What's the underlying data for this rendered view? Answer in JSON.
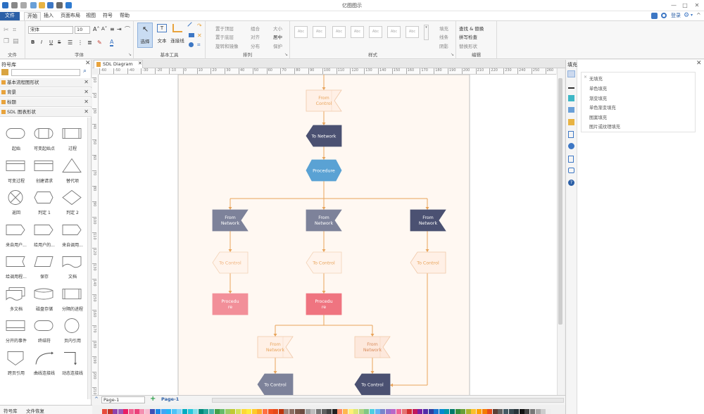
{
  "app": {
    "title": "亿图图示",
    "login_label": "登录",
    "settings_caret": "▾"
  },
  "menu": [
    {
      "label": "文件"
    },
    {
      "label": "开始"
    },
    {
      "label": "插入"
    },
    {
      "label": "页面布局"
    },
    {
      "label": "视图"
    },
    {
      "label": "符号"
    },
    {
      "label": "帮助"
    }
  ],
  "ribbon": {
    "groups": {
      "file": "文件",
      "font": "字体",
      "basic_tools": "基本工具",
      "arrange": "排列",
      "style": "样式",
      "edit": "编辑"
    },
    "font_name": "宋体",
    "font_size": "10",
    "format_buttons": [
      "B",
      "I",
      "U",
      "S"
    ],
    "tools": {
      "select": "选择",
      "text": "文本",
      "connector": "连接线"
    },
    "arrange": {
      "bring_front": "置于顶层",
      "send_back": "置于底层",
      "rotate": "旋转和镜像",
      "group": "组合",
      "align": "对齐",
      "distribute": "分布",
      "size": "大小",
      "center": "居中",
      "protect": "保护"
    },
    "style_thumb": "Abc",
    "fill": "填充",
    "line": "线条",
    "shadow": "阴影",
    "edit": {
      "find": "查找 & 替换",
      "spell": "拼写检查",
      "replace_shape": "替换形状"
    }
  },
  "library": {
    "title": "符号库",
    "search_placeholder": "",
    "categories": [
      {
        "label": "基本流程图形状"
      },
      {
        "label": "背景"
      },
      {
        "label": "标题"
      },
      {
        "label": "SDL 图表形状"
      }
    ],
    "shapes": [
      {
        "label": "起始"
      },
      {
        "label": "可变起始点"
      },
      {
        "label": "过程"
      },
      {
        "label": "可变过程"
      },
      {
        "label": "创建请求"
      },
      {
        "label": "替代项"
      },
      {
        "label": "返回"
      },
      {
        "label": "判定 1"
      },
      {
        "label": "判定 2"
      },
      {
        "label": "来自用户..."
      },
      {
        "label": "给用户的..."
      },
      {
        "label": "来自调用..."
      },
      {
        "label": "给调用程..."
      },
      {
        "label": "保存"
      },
      {
        "label": "文档"
      },
      {
        "label": "多文档"
      },
      {
        "label": "磁盘存储"
      },
      {
        "label": "分隔的进程"
      },
      {
        "label": "分开的事件"
      },
      {
        "label": "终结符"
      },
      {
        "label": "页内引用"
      },
      {
        "label": "跨页引用"
      },
      {
        "label": "曲线连接线"
      },
      {
        "label": "动态连接线"
      }
    ]
  },
  "bottom_tabs": {
    "library": "符号库",
    "recover": "文件恢复"
  },
  "doc_tab": "SDL Diagram",
  "page_tabs": {
    "current": "Page-1",
    "active": "Page-1",
    "add": "+"
  },
  "ruler": {
    "h": [
      "-60",
      "-50",
      "-40",
      "-30",
      "-20",
      "-10",
      "0",
      "10",
      "20",
      "30",
      "40",
      "50",
      "60",
      "70",
      "80",
      "90",
      "100",
      "110",
      "120",
      "130",
      "140",
      "150",
      "160",
      "170",
      "180",
      "190",
      "200",
      "210",
      "220",
      "230",
      "240",
      "250",
      "260"
    ],
    "v": [
      "10",
      "20",
      "30",
      "40",
      "50",
      "60",
      "70",
      "80",
      "90",
      "100",
      "110",
      "120",
      "130",
      "140",
      "150",
      "160",
      "170",
      "180",
      "190",
      "200",
      "210"
    ]
  },
  "diagram": {
    "colors": {
      "line": "#e8a45b",
      "dark": "#4b5172",
      "blue": "#5aa2d4",
      "pink": "#f28f99",
      "page": "#fff8f2"
    },
    "nodes": [
      {
        "label": "From\nControl"
      },
      {
        "label": "To Network"
      },
      {
        "label": "Procedure"
      },
      {
        "label": "From\nNetwork"
      },
      {
        "label": "From\nNetwork"
      },
      {
        "label": "From\nNetwork"
      },
      {
        "label": "To Control"
      },
      {
        "label": "To Control"
      },
      {
        "label": "To Control"
      },
      {
        "label": "Procedu\nre"
      },
      {
        "label": "Procedu\nre"
      },
      {
        "label": "From\nNetwork"
      },
      {
        "label": "From\nNetwork"
      },
      {
        "label": "To Control"
      },
      {
        "label": "To Control"
      }
    ]
  },
  "fill_panel": {
    "title": "填充",
    "options": [
      {
        "label": "无填充"
      },
      {
        "label": "单色填充"
      },
      {
        "label": "渐变填充"
      },
      {
        "label": "单色渐变填充"
      },
      {
        "label": "图案填充"
      },
      {
        "label": "图片或纹理填充"
      }
    ]
  },
  "palette": [
    "#e74c3c",
    "#c0392b",
    "#8e44ad",
    "#9b59b6",
    "#e91e63",
    "#f06292",
    "#ec407a",
    "#f48fb1",
    "#f8bbd0",
    "#3f51b5",
    "#1e88e5",
    "#42a5f5",
    "#29b6f6",
    "#4fc3f7",
    "#81d4fa",
    "#00acc1",
    "#26c6da",
    "#80deea",
    "#00897b",
    "#26a69a",
    "#4db6ac",
    "#43a047",
    "#66bb6a",
    "#9ccc65",
    "#c0ca33",
    "#d4e157",
    "#fdd835",
    "#ffeb3b",
    "#ffca28",
    "#ffa726",
    "#ff7043",
    "#f4511e",
    "#e64a19",
    "#bf360c",
    "#a1887f",
    "#8d6e63",
    "#795548",
    "#6d4c41",
    "#9e9e9e",
    "#bdbdbd",
    "#757575",
    "#616161",
    "#424242",
    "#212121",
    "#ff8a65",
    "#ffb74d",
    "#fff176",
    "#dce775",
    "#aed581",
    "#81c784",
    "#4dd0e1",
    "#64b5f6",
    "#7986cb",
    "#9575cd",
    "#ba68c8",
    "#f06292",
    "#e57373",
    "#d32f2f",
    "#c2185b",
    "#7b1fa2",
    "#512da8",
    "#303f9f",
    "#1976d2",
    "#0288d1",
    "#0097a7",
    "#00796b",
    "#388e3c",
    "#689f38",
    "#afb42b",
    "#fbc02d",
    "#ffa000",
    "#f57c00",
    "#e64a19",
    "#5d4037",
    "#616161",
    "#455a64",
    "#37474f",
    "#263238",
    "#111111",
    "#444444",
    "#777777",
    "#aaaaaa",
    "#cccccc",
    "#eeeeee"
  ]
}
